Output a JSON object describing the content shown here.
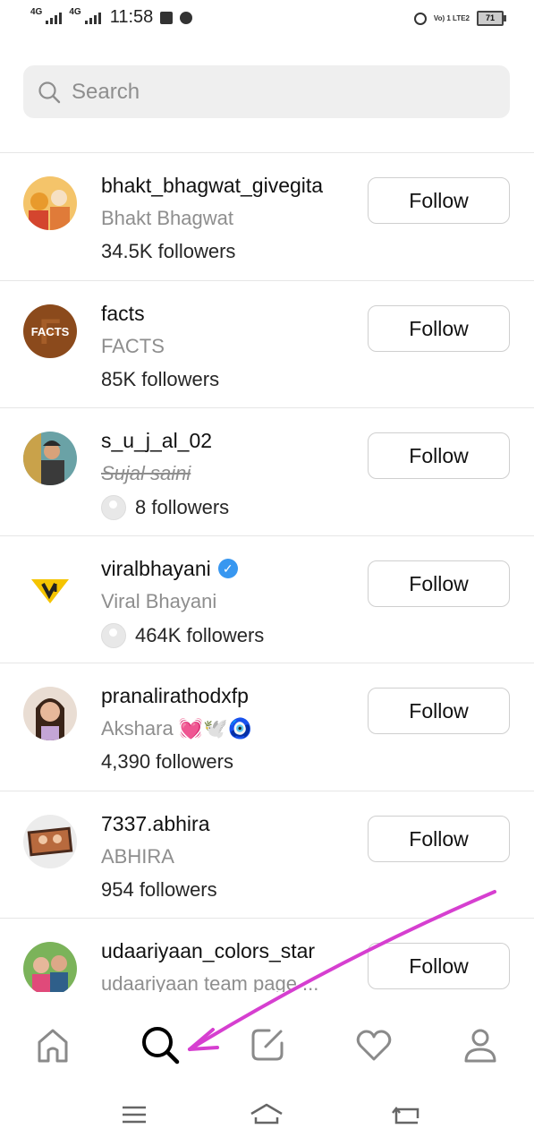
{
  "status_bar": {
    "network_1": "4G",
    "network_2": "4G",
    "time": "11:58",
    "volte": "Vo) 1 LTE2",
    "battery": "71"
  },
  "search": {
    "placeholder": "Search"
  },
  "accounts": [
    {
      "username": "bhakt_bhagwat_givegita",
      "name": "Bhakt Bhagwat",
      "followers": "34.5K followers",
      "button": "Follow"
    },
    {
      "username": "facts",
      "name": "FACTS",
      "followers": "85K followers",
      "button": "Follow",
      "avatar_text": "FACTS"
    },
    {
      "username": "s_u_j_al_02",
      "name": "Sujal saini",
      "followers": "8 followers",
      "button": "Follow"
    },
    {
      "username": "viralbhayani",
      "name": "Viral Bhayani",
      "followers": "464K followers",
      "button": "Follow",
      "verified_icon": "✓"
    },
    {
      "username": "pranalirathodxfp",
      "name": "Akshara 💓🕊️🧿",
      "followers": "4,390 followers",
      "button": "Follow"
    },
    {
      "username": "7337.abhira",
      "name": "ABHIRA",
      "followers": "954 followers",
      "button": "Follow"
    },
    {
      "username": "udaariyaan_colors_star",
      "name": "udaariyaan team page ...",
      "button": "Follow"
    }
  ],
  "bottom_nav": {
    "items": [
      "home-icon",
      "search-icon",
      "new-post-icon",
      "heart-icon",
      "profile-icon"
    ]
  },
  "colors": {
    "verified": "#3897f0",
    "annotation_arrow": "#d63fd0"
  }
}
